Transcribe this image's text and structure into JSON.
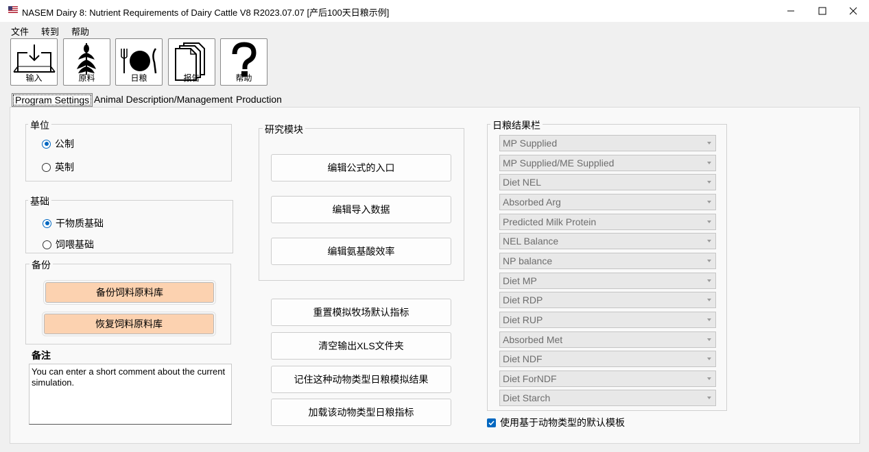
{
  "window": {
    "title": "NASEM Dairy 8: Nutrient Requirements of Dairy Cattle  V8 R2023.07.07 [产后100天日粮示例]"
  },
  "menu": [
    "文件",
    "转到",
    "帮助"
  ],
  "toolbar": [
    {
      "label": "输入",
      "icon": "import-icon"
    },
    {
      "label": "原料",
      "icon": "corn-icon"
    },
    {
      "label": "日粮",
      "icon": "plate-icon"
    },
    {
      "label": "报告",
      "icon": "documents-icon"
    },
    {
      "label": "帮助",
      "icon": "question-icon"
    }
  ],
  "tabs": [
    "Program Settings",
    "Animal Description/Management",
    "Production"
  ],
  "units": {
    "title": "单位",
    "options": [
      {
        "label": "公制",
        "selected": true
      },
      {
        "label": "英制",
        "selected": false
      }
    ]
  },
  "basis": {
    "title": "基础",
    "options": [
      {
        "label": "干物质基础",
        "selected": true
      },
      {
        "label": "饲喂基础",
        "selected": false
      }
    ]
  },
  "backup": {
    "title": "备份",
    "backup_label": "备份饲料原料库",
    "restore_label": "恢复饲料原料库"
  },
  "notes": {
    "title": "备注",
    "text": "You can enter a short comment about the current simulation."
  },
  "research": {
    "title": "研究模块",
    "buttons": [
      "编辑公式的入口",
      "编辑导入数据",
      "编辑氨基酸效率"
    ]
  },
  "actions": [
    "重置模拟牧场默认指标",
    "清空输出XLS文件夹",
    "记住这种动物类型日粮模拟结果",
    "加载该动物类型日粮指标"
  ],
  "results": {
    "title": "日粮结果栏",
    "items": [
      "MP Supplied",
      "MP Supplied/ME Supplied",
      "Diet NEL",
      "Absorbed Arg",
      "Predicted Milk Protein",
      "NEL Balance",
      "NP balance",
      "Diet MP",
      "Diet RDP",
      "Diet RUP",
      "Absorbed Met",
      "Diet NDF",
      "Diet ForNDF",
      "Diet Starch"
    ]
  },
  "default_template": {
    "label": "使用基于动物类型的默认模板",
    "checked": true
  },
  "colors": {
    "accent": "#0067c0",
    "peach": "#fcd2b0"
  }
}
